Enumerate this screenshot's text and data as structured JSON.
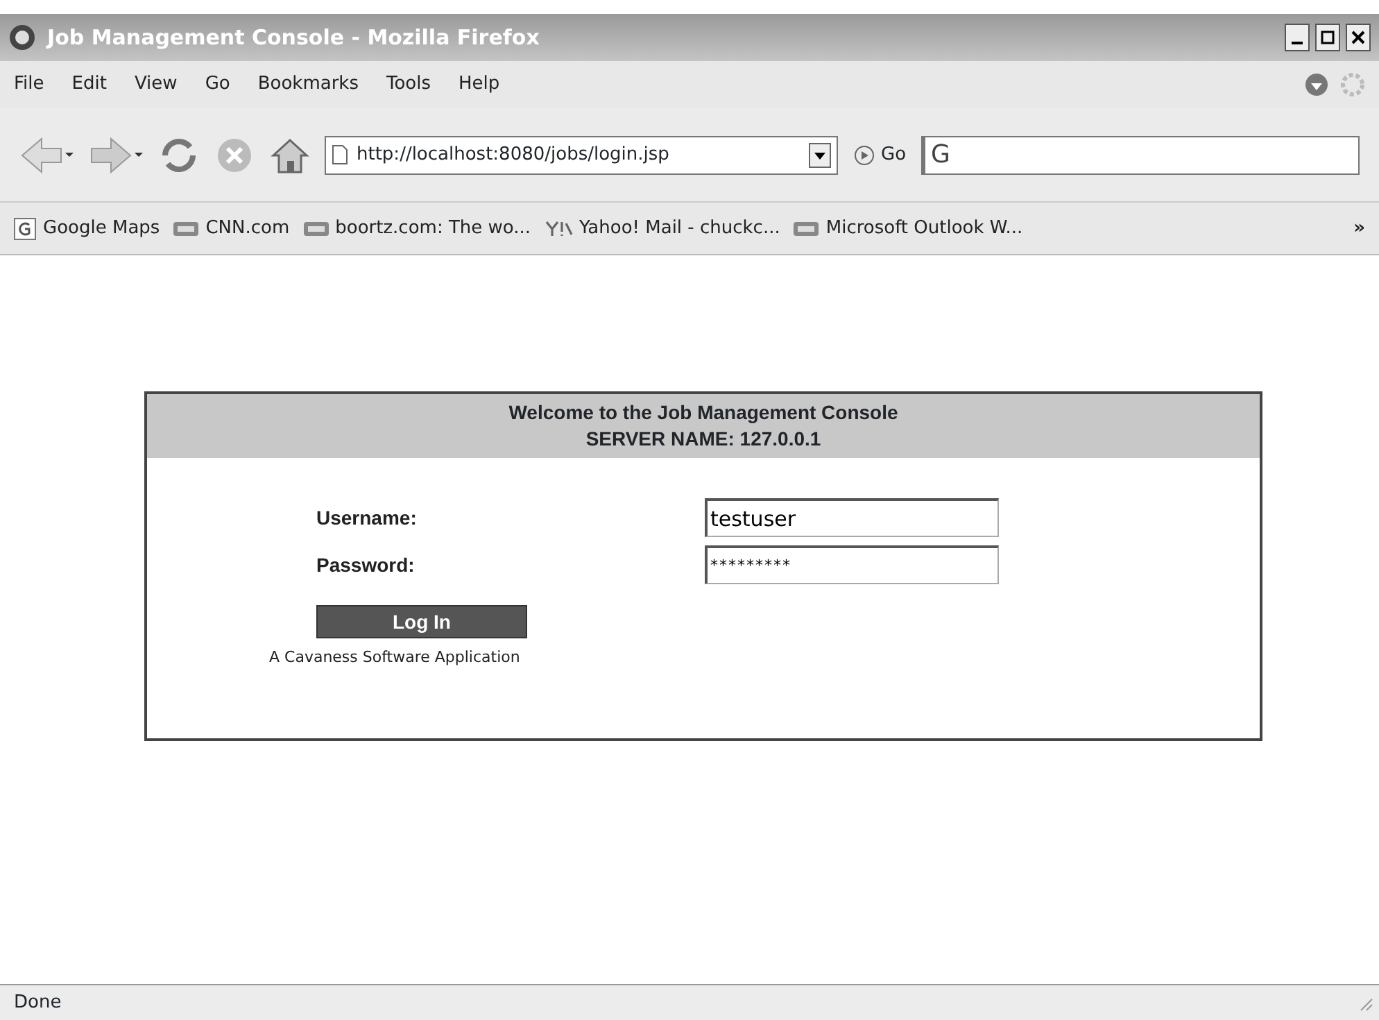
{
  "window": {
    "title": "Job Management Console - Mozilla Firefox"
  },
  "menu": [
    "File",
    "Edit",
    "View",
    "Go",
    "Bookmarks",
    "Tools",
    "Help"
  ],
  "toolbar": {
    "url": "http://localhost:8080/jobs/login.jsp",
    "go": "Go",
    "search_logo": "G"
  },
  "bookmarks": [
    {
      "kind": "google",
      "label": "Google Maps"
    },
    {
      "kind": "cnn",
      "label": "CNN.com"
    },
    {
      "kind": "cnn",
      "label": "boortz.com: The wo..."
    },
    {
      "kind": "yahoo",
      "label": "Yahoo! Mail - chuckc..."
    },
    {
      "kind": "cnn",
      "label": "Microsoft Outlook W..."
    }
  ],
  "bookmarks_more": "»",
  "login": {
    "heading": "Welcome to the Job Management Console",
    "server": "SERVER NAME: 127.0.0.1",
    "fields": [
      {
        "label": "Username:",
        "value": "testuser",
        "kind": "text"
      },
      {
        "label": "Password:",
        "value": "*********",
        "kind": "password"
      }
    ],
    "button": "Log In",
    "footer": "A Cavaness Software Application"
  },
  "status_bar": "Done"
}
